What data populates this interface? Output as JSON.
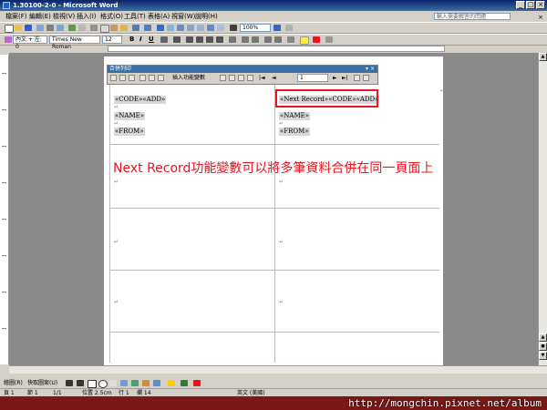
{
  "window": {
    "title": "1.30100-2-0 - Microsoft Word"
  },
  "menu": {
    "items": [
      "檔案(F)",
      "編輯(E)",
      "檢視(V)",
      "插入(I)",
      "格式(O)",
      "工具(T)",
      "表格(A)",
      "視窗(W)",
      "說明(H)"
    ],
    "help_placeholder": "輸入需要解答的問題"
  },
  "toolbar": {
    "zoom": "100%",
    "style": "內文 + 左: 0",
    "font": "Times New Roman",
    "size": "12"
  },
  "merge_toolbar": {
    "title": "合併列印",
    "insert_field": "插入功能變數",
    "record": "1"
  },
  "document": {
    "left_cell": {
      "line1": "«CODE»«ADD»",
      "line2": "«NAME»",
      "line3": "«FROM»"
    },
    "right_cell": {
      "line1": "«Next Record»«CODE»«ADD»",
      "line2": "«NAME»",
      "line3": "«FROM»"
    },
    "annotation": "Next Record功能變數可以將多筆資料合併在同一頁面上"
  },
  "drawing_toolbar": {
    "draw": "繪圖(R)",
    "autoshapes": "快取圖案(U)"
  },
  "status": {
    "page": "頁 1",
    "section": "節 1",
    "pages": "1/1",
    "position": "位置 2.5cm",
    "line": "行 1",
    "column": "欄 14",
    "language": "英文 (美國)"
  },
  "watermark": "http://mongchin.pixnet.net/album"
}
